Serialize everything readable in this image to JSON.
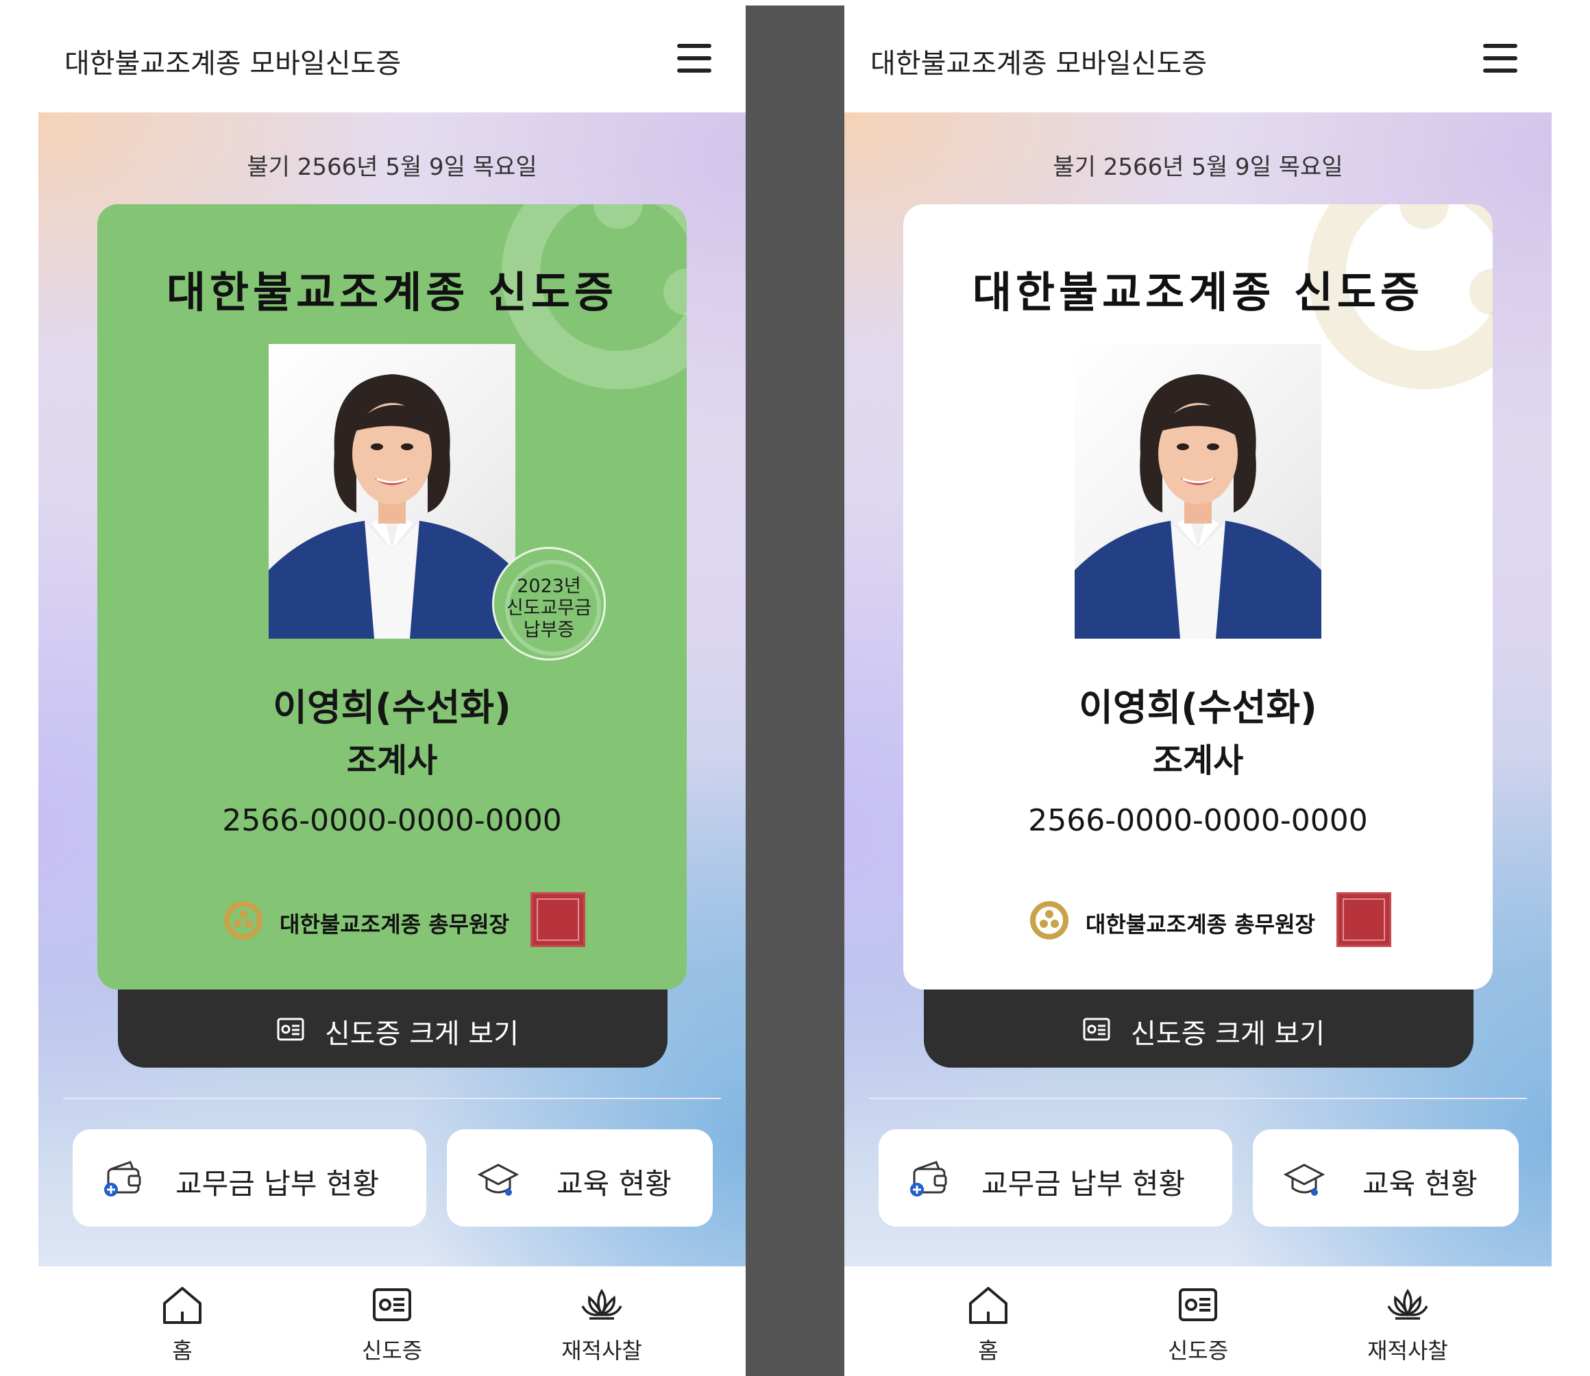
{
  "screens": [
    {
      "id": "left",
      "card_style": "green",
      "header": {
        "app_title": "대한불교조계종 모바일신도증"
      },
      "date": "불기 2566년 5월 9일 목요일",
      "card": {
        "title": "대한불교조계종 신도증",
        "badge": {
          "line1": "2023년",
          "line2": "신도교무금",
          "line3": "납부증"
        },
        "name": "이영희(수선화)",
        "rank": "조계사",
        "member_no": "2566-0000-0000-0000",
        "issuer": "대한불교조계종 총무원장"
      },
      "view_button": "신도증 크게 보기",
      "quick": {
        "payment": "교무금 납부 현황",
        "education": "교육 현황"
      },
      "nav": {
        "home": "홈",
        "card": "신도증",
        "temple": "재적사찰"
      }
    },
    {
      "id": "right",
      "card_style": "white",
      "header": {
        "app_title": "대한불교조계종 모바일신도증"
      },
      "date": "불기 2566년 5월 9일 목요일",
      "card": {
        "title": "대한불교조계종 신도증",
        "name": "이영희(수선화)",
        "rank": "조계사",
        "member_no": "2566-0000-0000-0000",
        "issuer": "대한불교조계종 총무원장"
      },
      "view_button": "신도증 크게 보기",
      "quick": {
        "payment": "교무금 납부 현황",
        "education": "교육 현황"
      },
      "nav": {
        "home": "홈",
        "card": "신도증",
        "temple": "재적사찰"
      }
    }
  ],
  "colors": {
    "card_green": "#83c574",
    "card_white": "#ffffff",
    "button_dark": "#2f2f2f",
    "gold": "#c9a24a",
    "seal_red": "#b8343c",
    "divider_gray": "#555555"
  },
  "icons": [
    "menu-icon",
    "id-card-icon",
    "wallet-icon",
    "graduation-cap-icon",
    "home-icon",
    "lotus-icon",
    "buddhist-logo-icon",
    "official-seal"
  ]
}
